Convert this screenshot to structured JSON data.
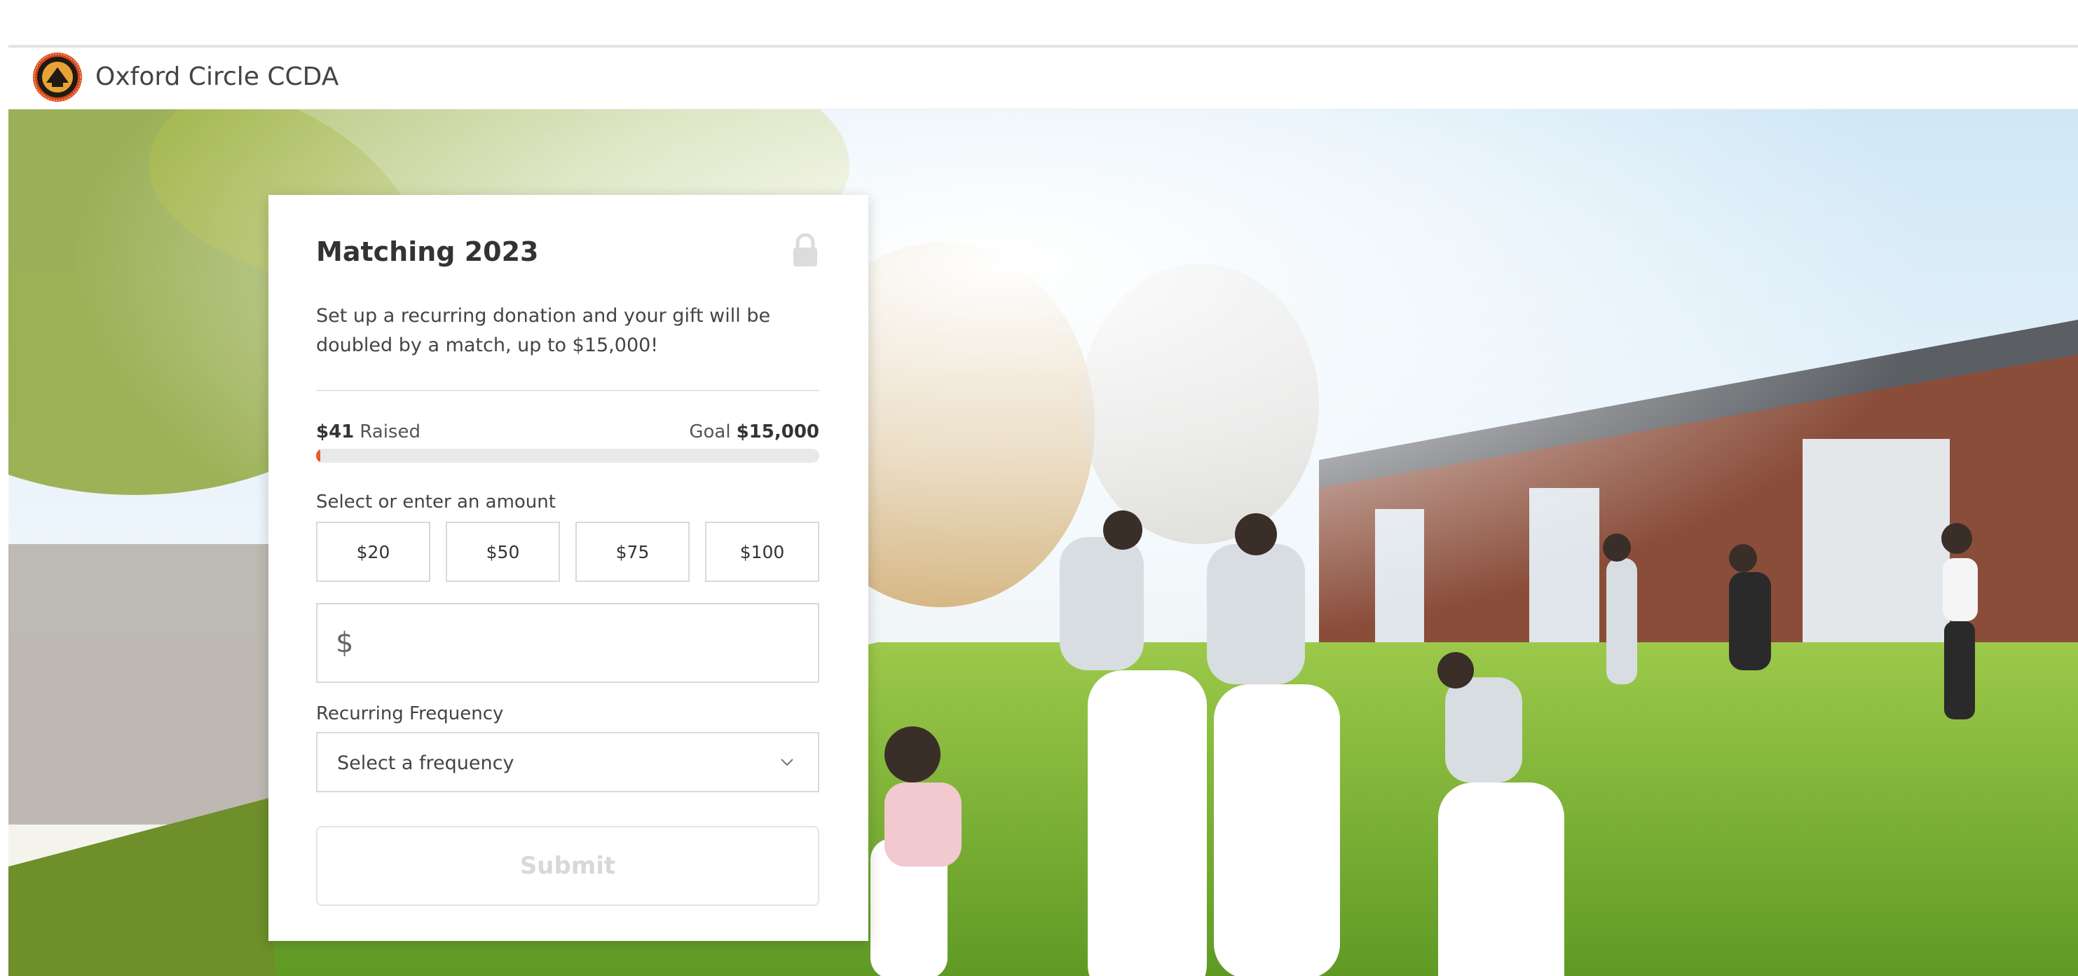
{
  "header": {
    "org_name": "Oxford Circle CCDA"
  },
  "campaign": {
    "title": "Matching 2023",
    "description": "Set up a recurring donation and your gift will be doubled by a match, up to $15,000!",
    "raised_amount": "$41",
    "raised_label": "Raised",
    "goal_label": "Goal",
    "goal_amount": "$15,000",
    "progress_fraction": 0.0027
  },
  "amount": {
    "label": "Select or enter an amount",
    "options": [
      "$20",
      "$50",
      "$75",
      "$100"
    ],
    "currency_symbol": "$",
    "custom_value": ""
  },
  "frequency": {
    "label": "Recurring Frequency",
    "selected": "Select a frequency"
  },
  "submit_label": "Submit",
  "icons": {
    "logo": "organization-seal-logo",
    "lock": "lock-icon",
    "chevron": "chevron-down-icon"
  },
  "colors": {
    "progress_fill": "#e8592a",
    "progress_track": "#e9e9e9",
    "border": "#d9d9d9",
    "submit_disabled_text": "#d8d8d8"
  }
}
